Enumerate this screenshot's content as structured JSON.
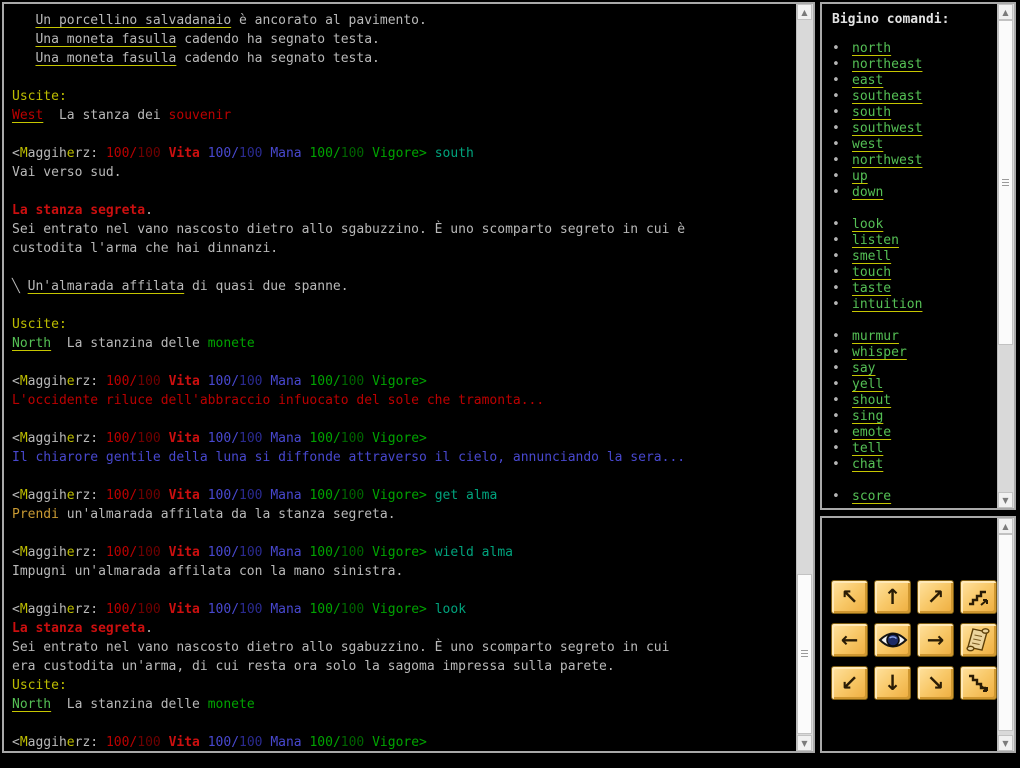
{
  "palette": {
    "fg": "#b9b9b9",
    "yel": "#bdbd00",
    "red": "#bb0000",
    "dred": "#6e0000",
    "bred": "#cc0f0f",
    "blu": "#4848cf",
    "dblu": "#2a2a90",
    "grn": "#00a300",
    "dgrn": "#006300",
    "tea": "#00a37d",
    "lnk": "#55c055",
    "org": "#c99a33",
    "ul": "#c6c600"
  },
  "icons": {
    "scroll_up": "▲",
    "scroll_down": "▼",
    "bullet": "•",
    "arrow_nw": "↖",
    "arrow_n": "↑",
    "arrow_ne": "↗",
    "arrow_w": "←",
    "arrow_e": "→",
    "arrow_sw": "↙",
    "arrow_s": "↓",
    "arrow_se": "↘"
  },
  "terminal": {
    "lines": [
      [
        [
          "   ",
          "fg"
        ],
        [
          "Un porcellino salvadanaio",
          "fg",
          "u"
        ],
        [
          " è ancorato al pavimento.",
          "fg"
        ]
      ],
      [
        [
          "   ",
          "fg"
        ],
        [
          "Una moneta fasulla",
          "fg",
          "u"
        ],
        [
          " cadendo ha segnato testa.",
          "fg"
        ]
      ],
      [
        [
          "   ",
          "fg"
        ],
        [
          "Una moneta fasulla",
          "fg",
          "u"
        ],
        [
          " cadendo ha segnato testa.",
          "fg"
        ]
      ],
      [],
      [
        [
          "Uscite:",
          "yel"
        ]
      ],
      [
        [
          "West",
          "red",
          "u"
        ],
        [
          "  La stanza dei ",
          "fg"
        ],
        [
          "souvenir",
          "red"
        ]
      ],
      [],
      [
        [
          "<",
          "fg"
        ],
        [
          "M",
          "yel"
        ],
        [
          "aggih",
          "fg"
        ],
        [
          "e",
          "yel"
        ],
        [
          "rz:",
          "fg"
        ],
        [
          " ",
          "fg"
        ],
        [
          "100",
          "red"
        ],
        [
          "/",
          "red"
        ],
        [
          "100",
          "dred"
        ],
        [
          " ",
          "fg"
        ],
        [
          "Vita",
          "bred",
          "b"
        ],
        [
          " ",
          "fg"
        ],
        [
          "100",
          "blu"
        ],
        [
          "/",
          "blu"
        ],
        [
          "100",
          "dblu"
        ],
        [
          " ",
          "fg"
        ],
        [
          "Mana",
          "blu"
        ],
        [
          " ",
          "fg"
        ],
        [
          "100",
          "grn"
        ],
        [
          "/",
          "grn"
        ],
        [
          "100",
          "dgrn"
        ],
        [
          " ",
          "fg"
        ],
        [
          "Vigore>",
          "grn"
        ],
        [
          " south",
          "tea"
        ]
      ],
      [
        [
          "Vai verso sud.",
          "fg"
        ]
      ],
      [],
      [
        [
          "La stanza segreta",
          "bred",
          "b"
        ],
        [
          ".",
          "fg"
        ]
      ],
      [
        [
          "Sei entrato nel vano nascosto dietro allo sgabuzzino. È uno scomparto segreto in cui è",
          "fg"
        ]
      ],
      [
        [
          "custodita l'arma che hai dinnanzi.",
          "fg"
        ]
      ],
      [],
      [
        [
          "╲ ",
          "fg"
        ],
        [
          "Un'almarada affilata",
          "fg",
          "u"
        ],
        [
          " di quasi due spanne.",
          "fg"
        ]
      ],
      [],
      [
        [
          "Uscite:",
          "yel"
        ]
      ],
      [
        [
          "North",
          "lnk",
          "u"
        ],
        [
          "  La stanzina delle ",
          "fg"
        ],
        [
          "monete",
          "grn"
        ]
      ],
      [],
      [
        [
          "<",
          "fg"
        ],
        [
          "M",
          "yel"
        ],
        [
          "aggih",
          "fg"
        ],
        [
          "e",
          "yel"
        ],
        [
          "rz:",
          "fg"
        ],
        [
          " ",
          "fg"
        ],
        [
          "100",
          "red"
        ],
        [
          "/",
          "red"
        ],
        [
          "100",
          "dred"
        ],
        [
          " ",
          "fg"
        ],
        [
          "Vita",
          "bred",
          "b"
        ],
        [
          " ",
          "fg"
        ],
        [
          "100",
          "blu"
        ],
        [
          "/",
          "blu"
        ],
        [
          "100",
          "dblu"
        ],
        [
          " ",
          "fg"
        ],
        [
          "Mana",
          "blu"
        ],
        [
          " ",
          "fg"
        ],
        [
          "100",
          "grn"
        ],
        [
          "/",
          "grn"
        ],
        [
          "100",
          "dgrn"
        ],
        [
          " ",
          "fg"
        ],
        [
          "Vigore>",
          "grn"
        ]
      ],
      [
        [
          "L'occidente riluce dell'abbraccio infuocato del sole che tramonta...",
          "red"
        ]
      ],
      [],
      [
        [
          "<",
          "fg"
        ],
        [
          "M",
          "yel"
        ],
        [
          "aggih",
          "fg"
        ],
        [
          "e",
          "yel"
        ],
        [
          "rz:",
          "fg"
        ],
        [
          " ",
          "fg"
        ],
        [
          "100",
          "red"
        ],
        [
          "/",
          "red"
        ],
        [
          "100",
          "dred"
        ],
        [
          " ",
          "fg"
        ],
        [
          "Vita",
          "bred",
          "b"
        ],
        [
          " ",
          "fg"
        ],
        [
          "100",
          "blu"
        ],
        [
          "/",
          "blu"
        ],
        [
          "100",
          "dblu"
        ],
        [
          " ",
          "fg"
        ],
        [
          "Mana",
          "blu"
        ],
        [
          " ",
          "fg"
        ],
        [
          "100",
          "grn"
        ],
        [
          "/",
          "grn"
        ],
        [
          "100",
          "dgrn"
        ],
        [
          " ",
          "fg"
        ],
        [
          "Vigore>",
          "grn"
        ]
      ],
      [
        [
          "Il chiarore gentile della luna si diffonde attraverso il cielo, annunciando la sera...",
          "blu"
        ]
      ],
      [],
      [
        [
          "<",
          "fg"
        ],
        [
          "M",
          "yel"
        ],
        [
          "aggih",
          "fg"
        ],
        [
          "e",
          "yel"
        ],
        [
          "rz:",
          "fg"
        ],
        [
          " ",
          "fg"
        ],
        [
          "100",
          "red"
        ],
        [
          "/",
          "red"
        ],
        [
          "100",
          "dred"
        ],
        [
          " ",
          "fg"
        ],
        [
          "Vita",
          "bred",
          "b"
        ],
        [
          " ",
          "fg"
        ],
        [
          "100",
          "blu"
        ],
        [
          "/",
          "blu"
        ],
        [
          "100",
          "dblu"
        ],
        [
          " ",
          "fg"
        ],
        [
          "Mana",
          "blu"
        ],
        [
          " ",
          "fg"
        ],
        [
          "100",
          "grn"
        ],
        [
          "/",
          "grn"
        ],
        [
          "100",
          "dgrn"
        ],
        [
          " ",
          "fg"
        ],
        [
          "Vigore>",
          "grn"
        ],
        [
          " get alma",
          "tea"
        ]
      ],
      [
        [
          "Prendi",
          "org"
        ],
        [
          " un'almarada affilata da la stanza segreta.",
          "fg"
        ]
      ],
      [],
      [
        [
          "<",
          "fg"
        ],
        [
          "M",
          "yel"
        ],
        [
          "aggih",
          "fg"
        ],
        [
          "e",
          "yel"
        ],
        [
          "rz:",
          "fg"
        ],
        [
          " ",
          "fg"
        ],
        [
          "100",
          "red"
        ],
        [
          "/",
          "red"
        ],
        [
          "100",
          "dred"
        ],
        [
          " ",
          "fg"
        ],
        [
          "Vita",
          "bred",
          "b"
        ],
        [
          " ",
          "fg"
        ],
        [
          "100",
          "blu"
        ],
        [
          "/",
          "blu"
        ],
        [
          "100",
          "dblu"
        ],
        [
          " ",
          "fg"
        ],
        [
          "Mana",
          "blu"
        ],
        [
          " ",
          "fg"
        ],
        [
          "100",
          "grn"
        ],
        [
          "/",
          "grn"
        ],
        [
          "100",
          "dgrn"
        ],
        [
          " ",
          "fg"
        ],
        [
          "Vigore>",
          "grn"
        ],
        [
          " wield alma",
          "tea"
        ]
      ],
      [
        [
          "Impugni un'almarada affilata con la mano sinistra.",
          "fg"
        ]
      ],
      [],
      [
        [
          "<",
          "fg"
        ],
        [
          "M",
          "yel"
        ],
        [
          "aggih",
          "fg"
        ],
        [
          "e",
          "yel"
        ],
        [
          "rz:",
          "fg"
        ],
        [
          " ",
          "fg"
        ],
        [
          "100",
          "red"
        ],
        [
          "/",
          "red"
        ],
        [
          "100",
          "dred"
        ],
        [
          " ",
          "fg"
        ],
        [
          "Vita",
          "bred",
          "b"
        ],
        [
          " ",
          "fg"
        ],
        [
          "100",
          "blu"
        ],
        [
          "/",
          "blu"
        ],
        [
          "100",
          "dblu"
        ],
        [
          " ",
          "fg"
        ],
        [
          "Mana",
          "blu"
        ],
        [
          " ",
          "fg"
        ],
        [
          "100",
          "grn"
        ],
        [
          "/",
          "grn"
        ],
        [
          "100",
          "dgrn"
        ],
        [
          " ",
          "fg"
        ],
        [
          "Vigore>",
          "grn"
        ],
        [
          " look",
          "tea"
        ]
      ],
      [
        [
          "La stanza segreta",
          "bred",
          "b"
        ],
        [
          ".",
          "fg"
        ]
      ],
      [
        [
          "Sei entrato nel vano nascosto dietro allo sgabuzzino. È uno scomparto segreto in cui",
          "fg"
        ]
      ],
      [
        [
          "era custodita un'arma, di cui resta ora solo la sagoma impressa sulla parete.",
          "fg"
        ]
      ],
      [
        [
          "Uscite:",
          "yel"
        ]
      ],
      [
        [
          "North",
          "lnk",
          "u"
        ],
        [
          "  La stanzina delle ",
          "fg"
        ],
        [
          "monete",
          "grn"
        ]
      ],
      [],
      [
        [
          "<",
          "fg"
        ],
        [
          "M",
          "yel"
        ],
        [
          "aggih",
          "fg"
        ],
        [
          "e",
          "yel"
        ],
        [
          "rz:",
          "fg"
        ],
        [
          " ",
          "fg"
        ],
        [
          "100",
          "red"
        ],
        [
          "/",
          "red"
        ],
        [
          "100",
          "dred"
        ],
        [
          " ",
          "fg"
        ],
        [
          "Vita",
          "bred",
          "b"
        ],
        [
          " ",
          "fg"
        ],
        [
          "100",
          "blu"
        ],
        [
          "/",
          "blu"
        ],
        [
          "100",
          "dblu"
        ],
        [
          " ",
          "fg"
        ],
        [
          "Mana",
          "blu"
        ],
        [
          " ",
          "fg"
        ],
        [
          "100",
          "grn"
        ],
        [
          "/",
          "grn"
        ],
        [
          "100",
          "dgrn"
        ],
        [
          " ",
          "fg"
        ],
        [
          "Vigore>",
          "grn"
        ]
      ]
    ]
  },
  "sidebar": {
    "title": "Bigino comandi:",
    "groups": [
      [
        "north",
        "northeast",
        "east",
        "southeast",
        "south",
        "southwest",
        "west",
        "northwest",
        "up",
        "down"
      ],
      [
        "look",
        "listen",
        "smell",
        "touch",
        "taste",
        "intuition"
      ],
      [
        "murmur",
        "whisper",
        "say",
        "yell",
        "shout",
        "sing",
        "emote",
        "tell",
        "chat"
      ],
      [
        "score"
      ]
    ]
  },
  "dpad": {
    "buttons": [
      "northwest",
      "north",
      "northeast",
      "up",
      "west",
      "look",
      "east",
      "read scroll",
      "southwest",
      "south",
      "southeast",
      "down"
    ]
  }
}
